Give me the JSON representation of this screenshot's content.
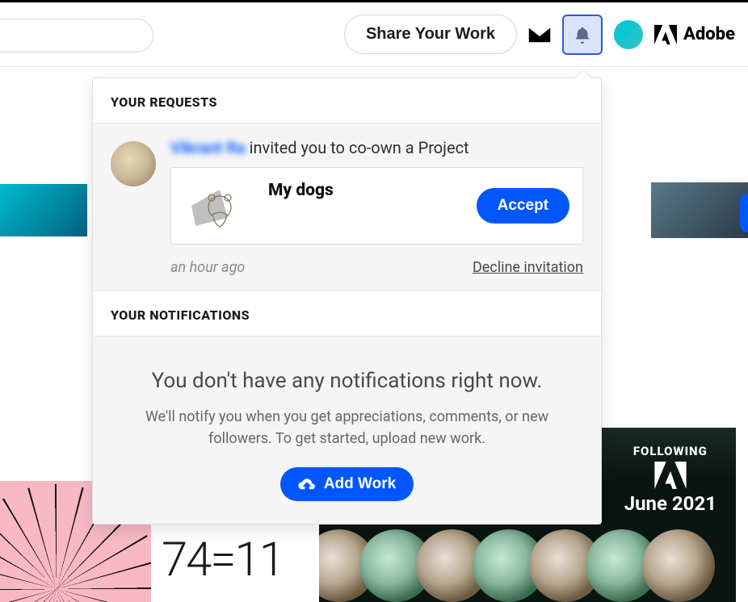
{
  "header": {
    "share_button": "Share Your Work",
    "adobe_label": "Adobe"
  },
  "dropdown": {
    "requests_heading": "YOUR REQUESTS",
    "notifications_heading": "YOUR NOTIFICATIONS",
    "request": {
      "inviter_name": "Vikrant Ra",
      "invite_text": " invited you to co-own a Project",
      "project_title": "My dogs",
      "accept_label": "Accept",
      "timestamp": "an hour ago",
      "decline_label": "Decline invitation"
    },
    "empty": {
      "title": "You don't have any notifications right now.",
      "body": "We'll notify you when you get appreciations, comments, or new followers. To get started, upload new work.",
      "add_work_label": "Add Work"
    }
  },
  "background": {
    "following_label": "FOLLOWING",
    "following_date": "June 2021",
    "mid_text": "74=11"
  }
}
